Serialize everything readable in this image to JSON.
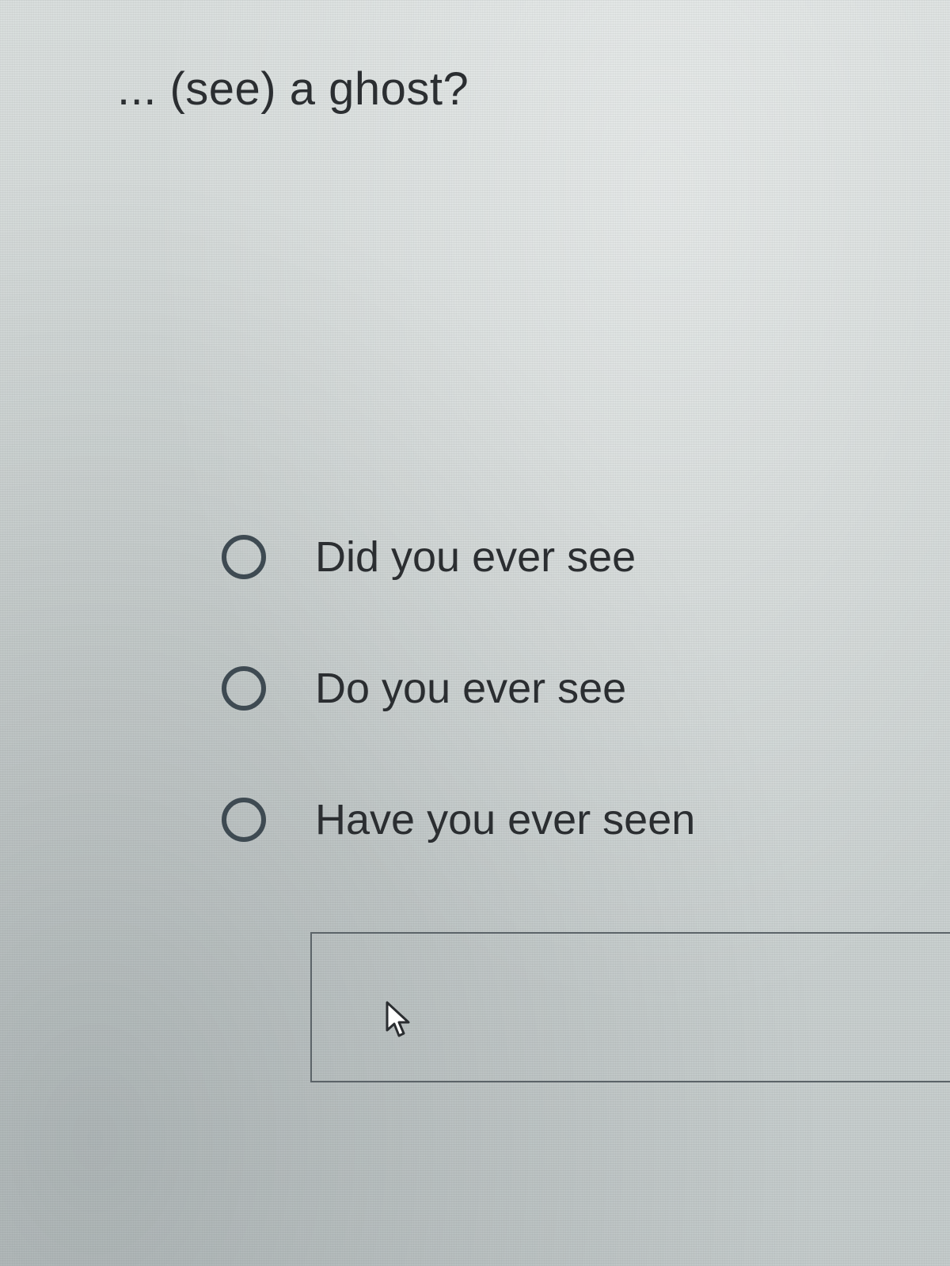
{
  "question": {
    "text": "... (see) a ghost?"
  },
  "options": [
    {
      "label": "Did you ever see",
      "selected": false
    },
    {
      "label": "Do you ever see",
      "selected": false
    },
    {
      "label": "Have you ever seen",
      "selected": false
    }
  ],
  "answer_box": {
    "value": ""
  },
  "icons": {
    "cursor": "mouse-pointer-arrow-icon"
  }
}
